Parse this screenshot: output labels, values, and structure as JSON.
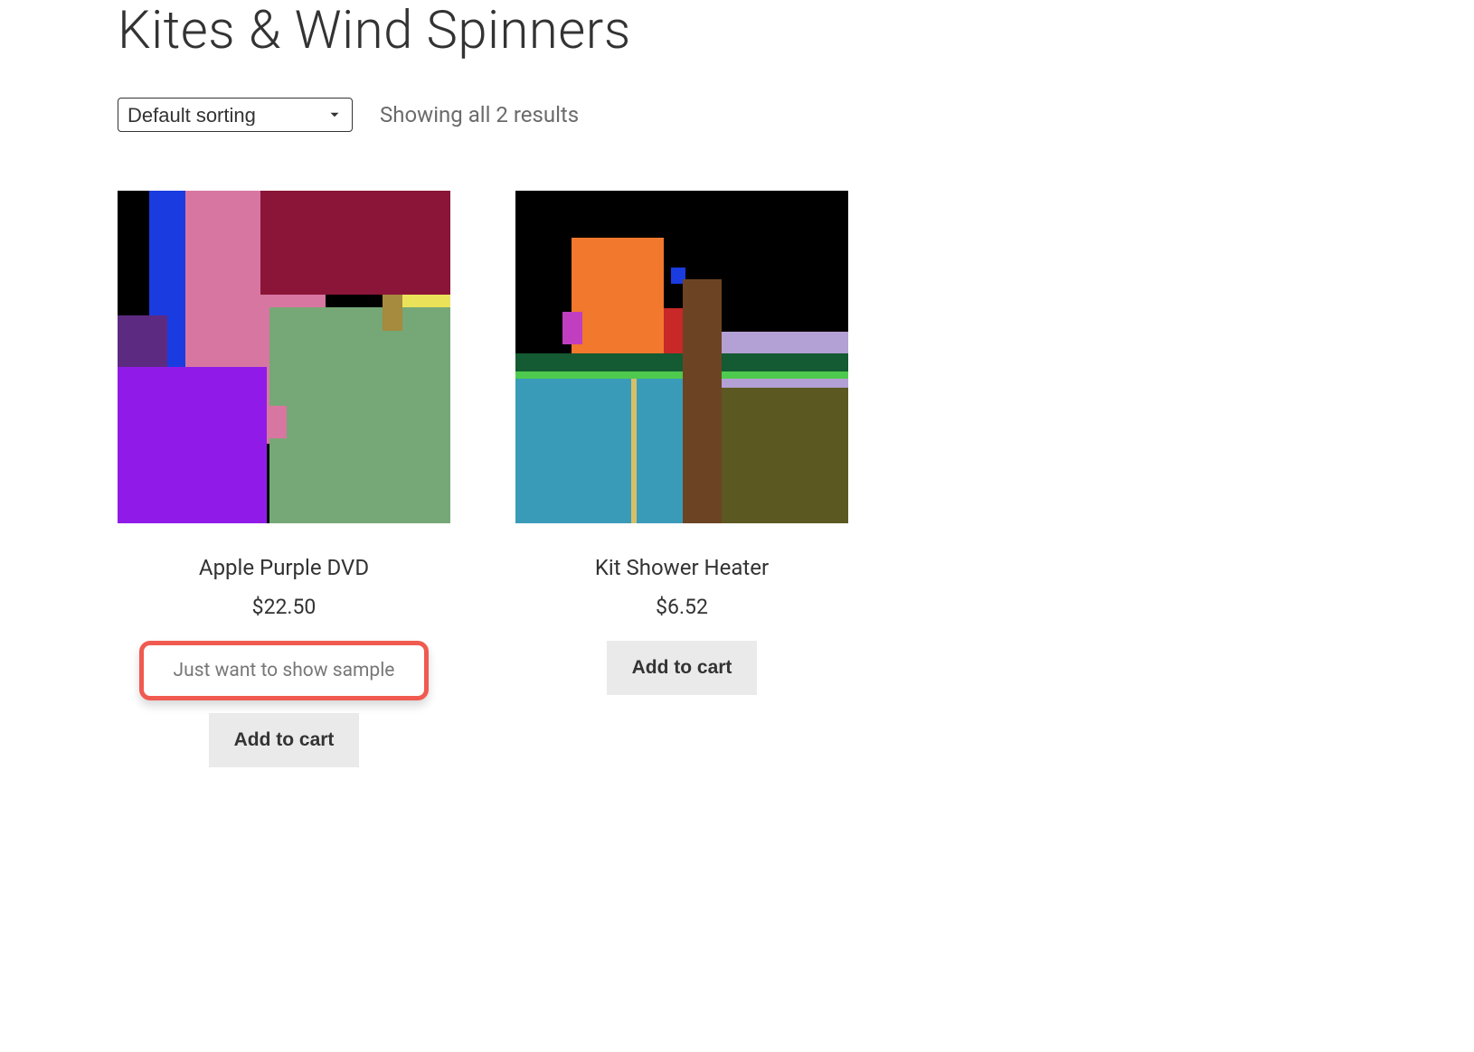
{
  "page": {
    "title": "Kites & Wind Spinners"
  },
  "toolbar": {
    "sort_selected": "Default sorting",
    "results_count": "Showing all 2 results"
  },
  "products": [
    {
      "title": "Apple Purple DVD",
      "price": "$22.50",
      "sample_text": "Just want to show sample",
      "cart_label": "Add to cart"
    },
    {
      "title": "Kit Shower Heater",
      "price": "$6.52",
      "cart_label": "Add to cart"
    }
  ]
}
